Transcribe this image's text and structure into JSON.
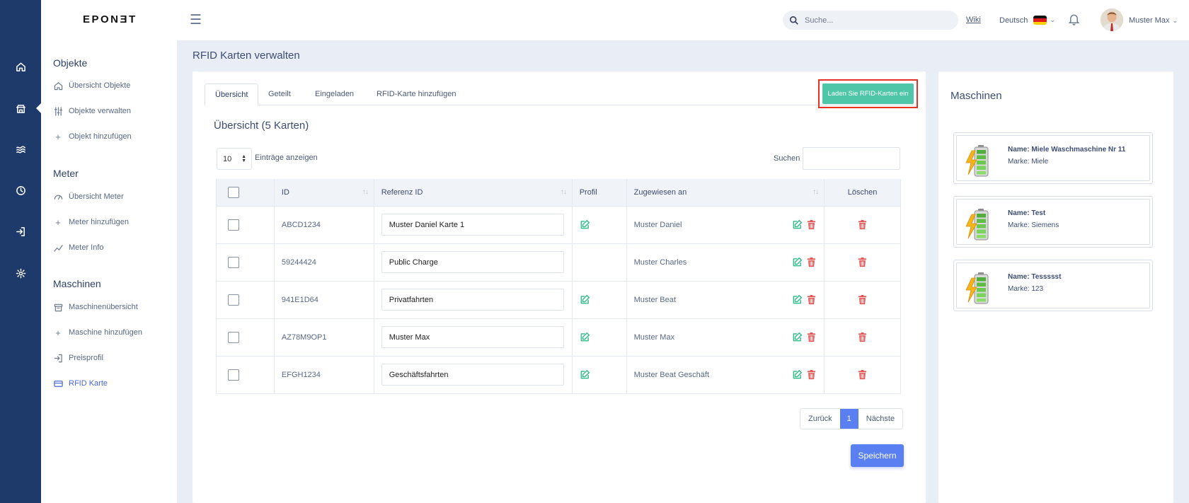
{
  "brand": {
    "logo_text": "EPONƎT"
  },
  "rail": {
    "icons": [
      "home-icon",
      "store-icon",
      "waves-icon",
      "clock-icon",
      "login-icon",
      "settings-icon"
    ]
  },
  "sidebar": {
    "sections": [
      {
        "title": "Objekte",
        "items": [
          {
            "label": "Übersicht Objekte",
            "icon": "home-icon"
          },
          {
            "label": "Objekte verwalten",
            "icon": "sliders-icon"
          },
          {
            "label": "Objekt hinzufügen",
            "icon": "plus-icon"
          }
        ]
      },
      {
        "title": "Meter",
        "items": [
          {
            "label": "Übersicht Meter",
            "icon": "gauge-icon"
          },
          {
            "label": "Meter hinzufügen",
            "icon": "plus-icon"
          },
          {
            "label": "Meter Info",
            "icon": "trend-icon"
          }
        ]
      },
      {
        "title": "Maschinen",
        "items": [
          {
            "label": "Maschinenübersicht",
            "icon": "archive-icon"
          },
          {
            "label": "Maschine hinzufügen",
            "icon": "plus-icon"
          },
          {
            "label": "Preisprofil",
            "icon": "login-icon"
          },
          {
            "label": "RFID Karte",
            "icon": "card-icon",
            "active": true
          }
        ]
      }
    ]
  },
  "topbar": {
    "search_placeholder": "Suche...",
    "wiki": "Wiki",
    "language": "Deutsch",
    "user_name": "Muster Max"
  },
  "page": {
    "title": "RFID Karten verwalten"
  },
  "tabs": [
    "Übersicht",
    "Geteilt",
    "Eingeladen",
    "RFID-Karte hinzufügen"
  ],
  "load_button": "Laden Sie RFID-Karten ein",
  "overview": {
    "title": "Übersicht (5 Karten)",
    "page_length": "10",
    "length_label": "Einträge anzeigen",
    "search_label": "Suchen"
  },
  "table": {
    "headers": {
      "id": "ID",
      "ref": "Referenz ID",
      "profile": "Profil",
      "assigned": "Zugewiesen an",
      "delete": "Löschen"
    },
    "rows": [
      {
        "id": "ABCD1234",
        "ref": "Muster Daniel Karte 1",
        "has_profile": true,
        "assigned": "Muster Daniel"
      },
      {
        "id": "59244424",
        "ref": "Public Charge",
        "has_profile": false,
        "assigned": "Muster Charles"
      },
      {
        "id": "941E1D64",
        "ref": "Privatfahrten",
        "has_profile": true,
        "assigned": "Muster Beat"
      },
      {
        "id": "AZ78M9OP1",
        "ref": "Muster Max",
        "has_profile": true,
        "assigned": "Muster Max"
      },
      {
        "id": "EFGH1234",
        "ref": "Geschäftsfahrten",
        "has_profile": true,
        "assigned": "Muster Beat Geschäft"
      }
    ]
  },
  "pager": {
    "prev": "Zurück",
    "current": "1",
    "next": "Nächste"
  },
  "save_button": "Speichern",
  "machines": {
    "title": "Maschinen",
    "items": [
      {
        "name": "Name: Miele Waschmaschine Nr 11",
        "brand": "Marke: Miele"
      },
      {
        "name": "Name: Test",
        "brand": "Marke: Siemens"
      },
      {
        "name": "Name: Tessssst",
        "brand": "Marke: 123"
      }
    ]
  },
  "colors": {
    "rail": "#1e3a6b",
    "accent": "#5a7ff0",
    "teal": "#4fc6a7",
    "danger": "#e5332a",
    "edit": "#3cbf8e",
    "trash": "#e35454"
  }
}
